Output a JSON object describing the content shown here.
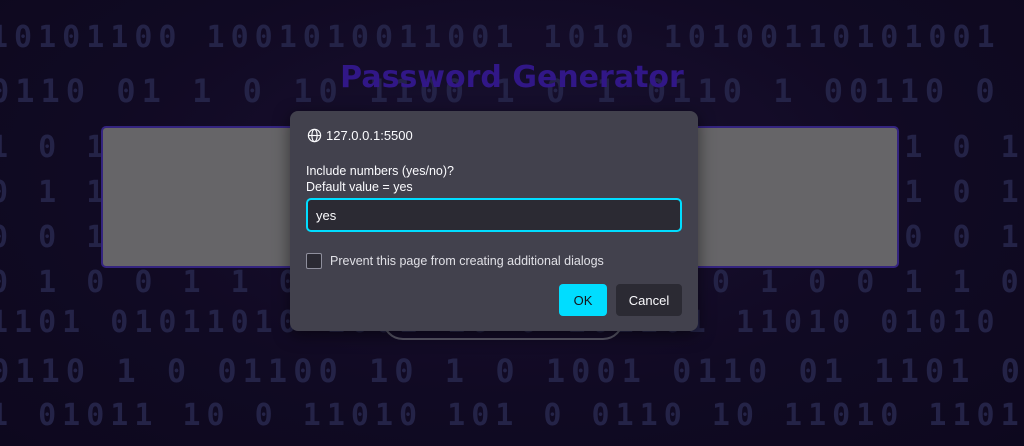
{
  "page": {
    "title": "Password Generator"
  },
  "dialog": {
    "origin": "127.0.0.1:5500",
    "message_line1": "Include numbers (yes/no)?",
    "message_line2": "Default value = yes",
    "input_value": "yes",
    "checkbox_label": "Prevent this page from creating additional dialogs",
    "ok_label": "OK",
    "cancel_label": "Cancel"
  },
  "colors": {
    "accent": "#00ddff",
    "dialog_bg": "#42414d",
    "title": "#3a1ba0"
  },
  "icons": {
    "origin": "globe-icon"
  }
}
